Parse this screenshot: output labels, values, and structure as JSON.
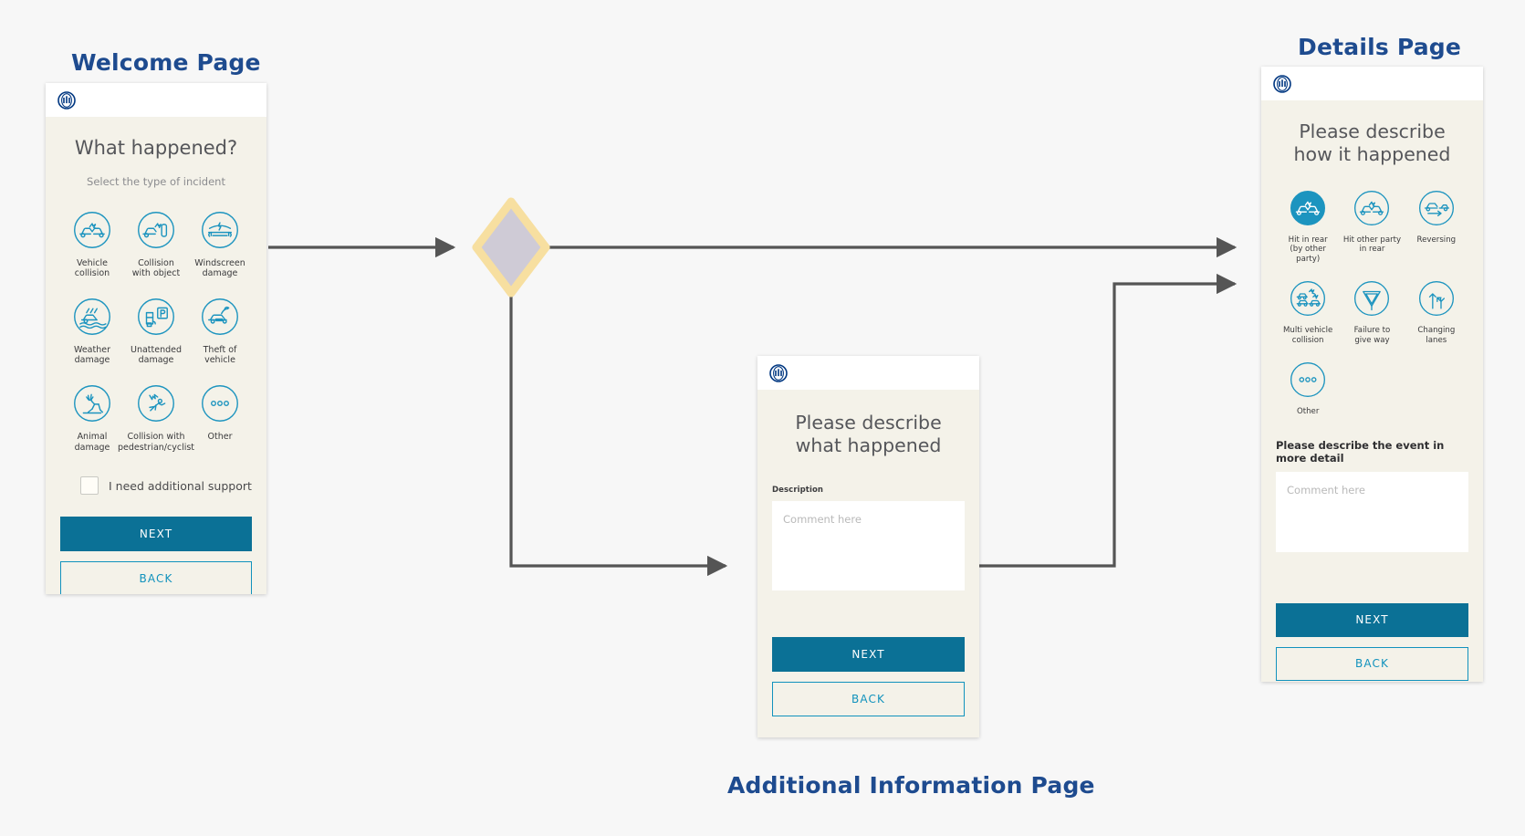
{
  "flow": {
    "captions": [
      {
        "id": "welcome",
        "text": "Welcome Page"
      },
      {
        "id": "details",
        "text": "Details Page"
      },
      {
        "id": "additional",
        "text": "Additional Information Page"
      }
    ],
    "decision_node": {
      "fill": "#cfcbd6",
      "stroke": "#f7dfa0"
    },
    "connector_color": "#555555"
  },
  "colors": {
    "brand_blue": "#003781",
    "accent_teal": "#0b7196",
    "link_blue": "#1192bd",
    "icon_blue": "#1c94bf",
    "card_bg": "#f4f2e9",
    "page_bg": "#f7f7f7",
    "caption_blue": "#1e4b8f"
  },
  "welcome_page": {
    "caption": "Welcome Page",
    "logo": "allianz-logo",
    "title": "What happened?",
    "subtitle": "Select the type of incident",
    "options": [
      {
        "icon": "vehicle-collision-icon",
        "label": "Vehicle\ncollision",
        "selected": false
      },
      {
        "icon": "collision-with-object-icon",
        "label": "Collision\nwith object",
        "selected": false
      },
      {
        "icon": "windscreen-damage-icon",
        "label": "Windscreen\ndamage",
        "selected": false
      },
      {
        "icon": "weather-damage-icon",
        "label": "Weather\ndamage",
        "selected": false
      },
      {
        "icon": "unattended-damage-icon",
        "label": "Unattended\ndamage",
        "selected": false
      },
      {
        "icon": "theft-of-vehicle-icon",
        "label": "Theft of\nvehicle",
        "selected": false
      },
      {
        "icon": "animal-damage-icon",
        "label": "Animal\ndamage",
        "selected": false
      },
      {
        "icon": "collision-with-pedestrian-icon",
        "label": "Collision with\npedestrian/cyclist",
        "selected": false
      },
      {
        "icon": "other-icon",
        "label": "Other",
        "selected": false
      }
    ],
    "checkbox": {
      "label": "I need additional support",
      "checked": false
    },
    "next_label": "NEXT",
    "back_label": "BACK"
  },
  "additional_info_page": {
    "caption": "Additional Information Page",
    "logo": "allianz-logo",
    "title": "Please describe what happened",
    "field_label": "Description",
    "textarea_placeholder": "Comment here",
    "textarea_value": "",
    "next_label": "NEXT",
    "back_label": "BACK"
  },
  "details_page": {
    "caption": "Details Page",
    "logo": "allianz-logo",
    "title": "Please describe how it happened",
    "options": [
      {
        "icon": "hit-in-rear-icon",
        "label": "Hit in rear\n(by other party)",
        "selected": true
      },
      {
        "icon": "hit-other-party-in-rear-icon",
        "label": "Hit other party\nin rear",
        "selected": false
      },
      {
        "icon": "reversing-icon",
        "label": "Reversing",
        "selected": false
      },
      {
        "icon": "multi-vehicle-collision-icon",
        "label": "Multi vehicle\ncollision",
        "selected": false
      },
      {
        "icon": "failure-to-give-way-icon",
        "label": "Failure to\ngive way",
        "selected": false
      },
      {
        "icon": "changing-lanes-icon",
        "label": "Changing\nlanes",
        "selected": false
      },
      {
        "icon": "other-icon",
        "label": "Other",
        "selected": false
      }
    ],
    "detail_prompt": "Please describe the event in more detail",
    "textarea_placeholder": "Comment here",
    "textarea_value": "",
    "next_label": "NEXT",
    "back_label": "BACK"
  }
}
